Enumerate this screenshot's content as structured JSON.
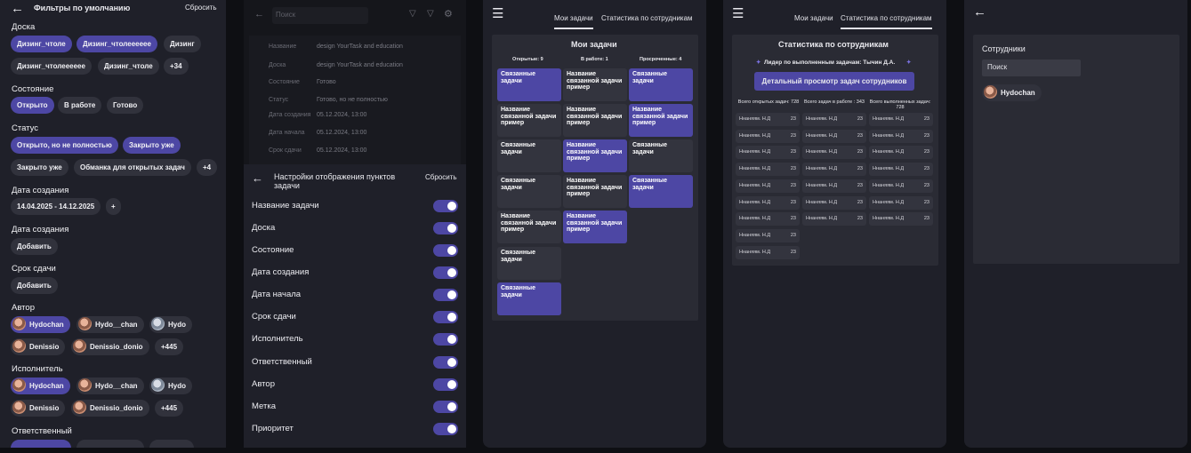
{
  "p1": {
    "title": "Фильтры по умолчанию",
    "reset": "Сбросить",
    "board": {
      "label": "Доска",
      "chips": [
        "Дизинг_чтоле",
        "Дизинг_чтолееееее",
        "Дизинг",
        "Дизинг_чтолееееее",
        "Дизинг_чтоле",
        "+34"
      ]
    },
    "state": {
      "label": "Состояние",
      "chips": [
        "Открыто",
        "В работе",
        "Готово"
      ]
    },
    "status": {
      "label": "Статус",
      "chips": [
        "Открыто, но не полностью",
        "Закрыто уже",
        "Закрыто уже",
        "Обманка для открытых задач",
        "+4"
      ]
    },
    "created": {
      "label": "Дата создания",
      "range": "14.04.2025 - 14.12.2025",
      "plus": "+"
    },
    "created2": {
      "label": "Дата создания",
      "add": "Добавить"
    },
    "due": {
      "label": "Срок сдачи",
      "add": "Добавить"
    },
    "author": {
      "label": "Автор",
      "chips": [
        "Hydochan",
        "Hydo__chan",
        "Hydo",
        "Denissio",
        "Denissio_donio",
        "+445"
      ]
    },
    "executor": {
      "label": "Исполнитель",
      "chips": [
        "Hydochan",
        "Hydo__chan",
        "Hydo",
        "Denissio",
        "Denissio_donio",
        "+445"
      ]
    },
    "responsible": {
      "label": "Ответственный"
    }
  },
  "p2": {
    "search_placeholder": "Поиск",
    "rows": [
      [
        "Название",
        "design YourTask and education"
      ],
      [
        "Доска",
        "design YourTask and education"
      ],
      [
        "Состояние",
        "Готово"
      ],
      [
        "Статус",
        "Готово, но не полностью"
      ],
      [
        "Дата создания",
        "05.12.2024, 13:00"
      ],
      [
        "Дата начала",
        "05.12.2024, 13:00"
      ],
      [
        "Срок сдачи",
        "05.12.2024, 13:00"
      ]
    ],
    "sheet_title": "Настройки отображения пунктов задачи",
    "reset": "Сбросить",
    "toggles": [
      "Название задачи",
      "Доска",
      "Состояние",
      "Дата создания",
      "Дата начала",
      "Срок сдачи",
      "Исполнитель",
      "Ответственный",
      "Автор",
      "Метка",
      "Приоритет"
    ]
  },
  "p3": {
    "tabs": [
      "Мои задачи",
      "Статистика по сотрудникам"
    ],
    "title": "Мои задачи",
    "cols": [
      "Открытые: 9",
      "В работе: 1",
      "Просроченные: 4"
    ],
    "c1": [
      "Связанные задачи",
      "Название связанной задачи пример",
      "Связанные задачи",
      "Связанные задачи",
      "Название связанной задачи пример",
      "Связанные задачи",
      "Связанные задачи"
    ],
    "c2": [
      "Название связанной задачи пример",
      "Название связанной задачи пример",
      "Название связанной задачи пример",
      "Название связанной задачи пример",
      "Название связанной задачи пример"
    ],
    "c3": [
      "Связанные задачи",
      "Название связанной задачи пример",
      "Связанные задачи",
      "Связанные задачи"
    ]
  },
  "p4": {
    "tabs": [
      "Мои задачи",
      "Статистика по сотрудникам"
    ],
    "title": "Статистика по сотрудникам",
    "leader": "Лидер по выполненным задачам: Тычин Д.А.",
    "button": "Детальный просмотр задач сотрудников",
    "heads": [
      "Всего открытых задач: 728",
      "Всего задач в работе : 343",
      "Всего выполненных задач: 728"
    ],
    "name": "Ннаняям. Н.Д",
    "num": "23"
  },
  "p5": {
    "title": "Сотрудники",
    "search_placeholder": "Поиск",
    "user": "Hydochan"
  }
}
